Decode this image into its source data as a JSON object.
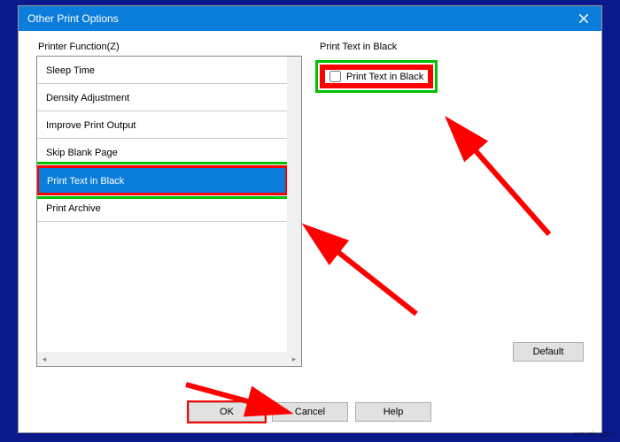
{
  "dialog": {
    "title": "Other Print Options",
    "close_icon": "close"
  },
  "left": {
    "label": "Printer Function(Z)",
    "items": [
      {
        "label": "Sleep Time",
        "selected": false
      },
      {
        "label": "Density Adjustment",
        "selected": false
      },
      {
        "label": "Improve Print Output",
        "selected": false
      },
      {
        "label": "Skip Blank Page",
        "selected": false
      },
      {
        "label": "Print Text in Black",
        "selected": true
      },
      {
        "label": "Print Archive",
        "selected": false
      }
    ]
  },
  "right": {
    "group_label": "Print Text in Black",
    "checkbox_label": "Print Text in Black",
    "checkbox_checked": false,
    "default_button": "Default"
  },
  "footer": {
    "ok": "OK",
    "cancel": "Cancel",
    "help": "Help"
  },
  "annotations": {
    "arrow_color": "#ff0000",
    "highlight_green": "#00c000",
    "highlight_red": "#ff0000"
  },
  "watermark": "wsxdn.com"
}
